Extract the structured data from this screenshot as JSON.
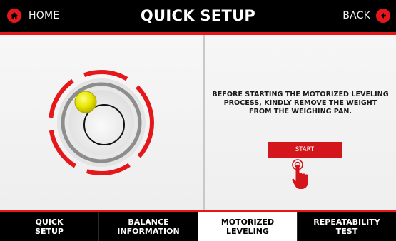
{
  "header": {
    "home_label": "HOME",
    "title": "QUICK SETUP",
    "back_label": "BACK",
    "home_icon": "home-icon",
    "back_icon": "back-arrow-icon",
    "accent_color": "#e4171b"
  },
  "main": {
    "instruction": "BEFORE STARTING THE MOTORIZED LEVELING PROCESS, KINDLY REMOVE THE WEIGHT FROM THE WEIGHING PAN.",
    "start_label": "START",
    "level_indicator_icon": "bubble-level-icon",
    "tap_icon": "hand-tap-icon"
  },
  "tabs": [
    {
      "line1": "QUICK",
      "line2": "SETUP",
      "active": false
    },
    {
      "line1": "BALANCE",
      "line2": "INFORMATION",
      "active": false
    },
    {
      "line1": "MOTORIZED",
      "line2": "LEVELING",
      "active": true
    },
    {
      "line1": "REPEATABILITY",
      "line2": "TEST",
      "active": false
    }
  ]
}
